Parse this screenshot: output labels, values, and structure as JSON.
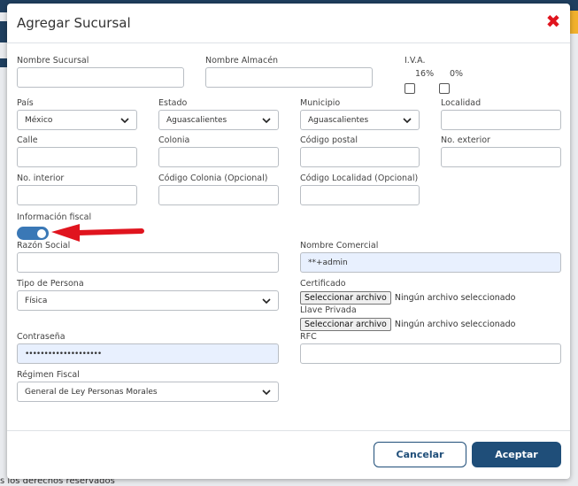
{
  "background": {
    "footer_text": "s los derechos reservados"
  },
  "modal": {
    "title": "Agregar Sucursal",
    "fields": {
      "nombre_sucursal": {
        "label": "Nombre Sucursal",
        "value": ""
      },
      "nombre_almacen": {
        "label": "Nombre Almacén",
        "value": ""
      },
      "iva": {
        "label": "I.V.A.",
        "opt16": "16%",
        "opt0": "0%"
      },
      "pais": {
        "label": "País",
        "value": "México"
      },
      "estado": {
        "label": "Estado",
        "value": "Aguascalientes"
      },
      "municipio": {
        "label": "Municipio",
        "value": "Aguascalientes"
      },
      "localidad": {
        "label": "Localidad",
        "value": ""
      },
      "calle": {
        "label": "Calle",
        "value": ""
      },
      "colonia": {
        "label": "Colonia",
        "value": ""
      },
      "codigo_postal": {
        "label": "Código postal",
        "value": ""
      },
      "no_exterior": {
        "label": "No. exterior",
        "value": ""
      },
      "no_interior": {
        "label": "No. interior",
        "value": ""
      },
      "codigo_colonia": {
        "label": "Código Colonia (Opcional)",
        "value": ""
      },
      "codigo_localidad": {
        "label": "Código Localidad (Opcional)",
        "value": ""
      },
      "info_fiscal": {
        "label": "Información fiscal",
        "enabled": true
      },
      "razon_social": {
        "label": "Razón Social",
        "value": ""
      },
      "nombre_comercial": {
        "label": "Nombre Comercial",
        "value": "**+admin"
      },
      "tipo_persona": {
        "label": "Tipo de Persona",
        "value": "Física"
      },
      "certificado": {
        "label": "Certificado",
        "button": "Seleccionar archivo",
        "status": "Ningún archivo seleccionado"
      },
      "llave_privada": {
        "label": "Llave Privada",
        "button": "Seleccionar archivo",
        "status": "Ningún archivo seleccionado"
      },
      "contrasena": {
        "label": "Contraseña",
        "value": "••••••••••••••••••••"
      },
      "rfc": {
        "label": "RFC",
        "value": ""
      },
      "regimen_fiscal": {
        "label": "Régimen Fiscal",
        "value": "General de Ley Personas Morales"
      }
    },
    "buttons": {
      "cancel": "Cancelar",
      "accept": "Aceptar"
    }
  },
  "colors": {
    "accent": "#1f4e79",
    "toggle": "#3a78b6",
    "close": "#e0141e",
    "annotation_arrow": "#e0141e"
  }
}
